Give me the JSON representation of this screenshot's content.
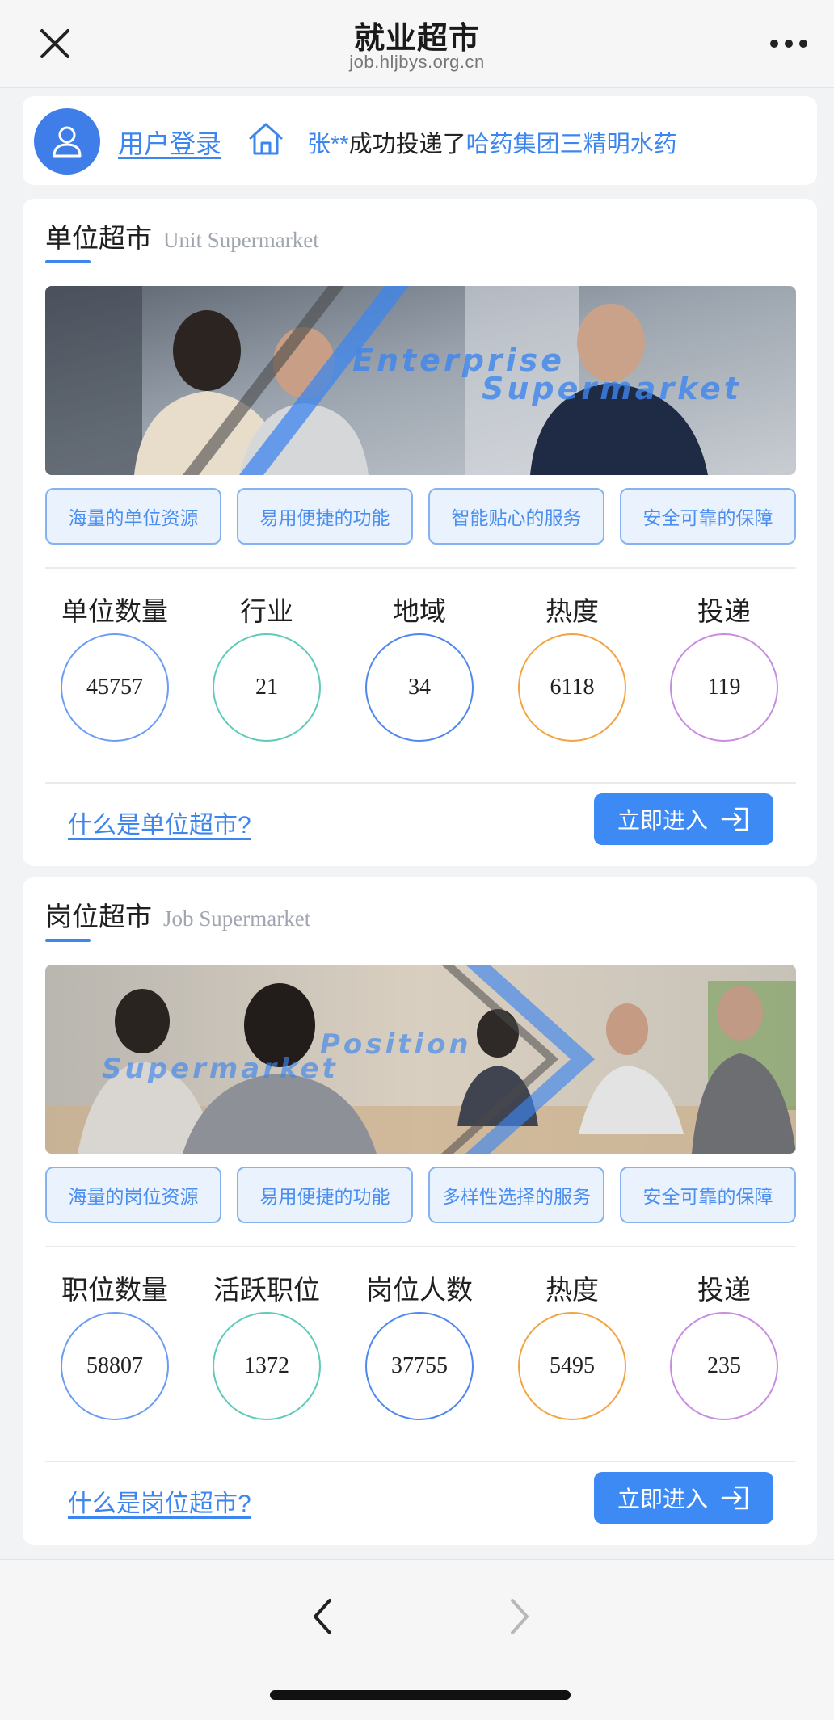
{
  "nav": {
    "title": "就业超市",
    "url": "job.hljbys.org.cn"
  },
  "login": {
    "link": "用户登录",
    "ticker_name": "张**",
    "ticker_action": "成功投递了",
    "ticker_company": "哈药集团三精明水药"
  },
  "unit": {
    "title_cn": "单位超市",
    "title_en": "Unit Supermarket",
    "banner_text_1": "Enterprise",
    "banner_text_2": "Supermarket",
    "features": [
      "海量的单位资源",
      "易用便捷的功能",
      "智能贴心的服务",
      "安全可靠的保障"
    ],
    "stats": [
      {
        "label": "单位数量",
        "value": "45757",
        "color": "#6b9cf2"
      },
      {
        "label": "行业",
        "value": "21",
        "color": "#5fcab9"
      },
      {
        "label": "地域",
        "value": "34",
        "color": "#4e88ee"
      },
      {
        "label": "热度",
        "value": "6118",
        "color": "#f2a443"
      },
      {
        "label": "投递",
        "value": "119",
        "color": "#c88ce0"
      }
    ],
    "what_link": "什么是单位超市?",
    "enter": "立即进入"
  },
  "job": {
    "title_cn": "岗位超市",
    "title_en": "Job Supermarket",
    "banner_text_1": "Position",
    "banner_text_2": "Supermarket",
    "features": [
      "海量的岗位资源",
      "易用便捷的功能",
      "多样性选择的服务",
      "安全可靠的保障"
    ],
    "stats": [
      {
        "label": "职位数量",
        "value": "58807",
        "color": "#6b9cf2"
      },
      {
        "label": "活跃职位",
        "value": "1372",
        "color": "#5fcab9"
      },
      {
        "label": "岗位人数",
        "value": "37755",
        "color": "#4e88ee"
      },
      {
        "label": "热度",
        "value": "5495",
        "color": "#f2a443"
      },
      {
        "label": "投递",
        "value": "235",
        "color": "#c88ce0"
      }
    ],
    "what_link": "什么是岗位超市?",
    "enter": "立即进入"
  },
  "icons": {
    "close": "close-icon",
    "more": "more-icon",
    "avatar": "user-icon",
    "home": "home-icon",
    "enter": "exit-arrow-icon",
    "back": "chevron-left-icon",
    "forward": "chevron-right-icon"
  },
  "colors": {
    "accent": "#3d86ee",
    "button": "#3d8af5"
  }
}
